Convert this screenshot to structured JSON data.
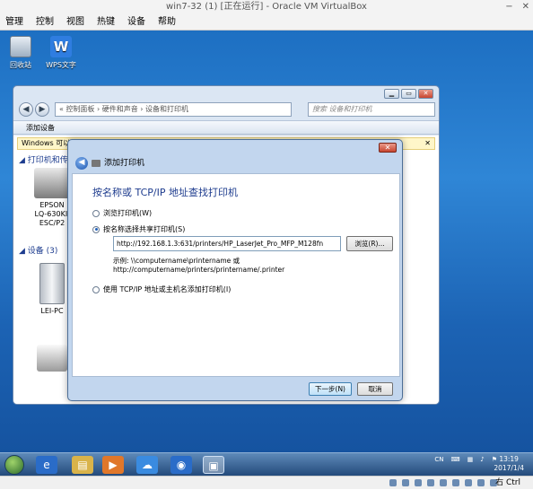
{
  "vbox": {
    "title": "win7-32 (1) [正在运行] - Oracle VM VirtualBox",
    "menu": [
      "管理",
      "控制",
      "视图",
      "热键",
      "设备",
      "帮助"
    ],
    "host_key": "右 Ctrl"
  },
  "desktop": {
    "icons": [
      {
        "label": "回收站",
        "icon": "recycle-bin-icon"
      },
      {
        "label": "WPS文字",
        "icon": "wps-writer-icon"
      }
    ]
  },
  "explorer": {
    "address": "« 控制面板 › 硬件和声音 › 设备和打印机",
    "search_placeholder": "搜索 设备和打印机",
    "toolbar_label": "添加设备",
    "info_bar": "Windows 可以显",
    "printers_group": "打印机和传",
    "devices_group": "设备 (3)",
    "printer_label_lines": [
      "EPSON",
      "LQ-630KII",
      "ESC/P2"
    ],
    "device_label": "LEI-PC"
  },
  "dialog": {
    "title": "添加打印机",
    "heading": "按名称或 TCP/IP 地址查找打印机",
    "option_browse": "浏览打印机(W)",
    "option_shared": "按名称选择共享打印机(S)",
    "url_value": "http://192.168.1.3:631/printers/HP_LaserJet_Pro_MFP_M128fn",
    "browse_button": "浏览(R)...",
    "example_line1": "示例: \\\\computername\\printername 或",
    "example_line2": "http://computername/printers/printername/.printer",
    "option_tcp": "使用 TCP/IP 地址或主机名添加打印机(I)",
    "next_button": "下一步(N)",
    "cancel_button": "取消"
  },
  "taskbar": {
    "lang": "CN",
    "time": "13:19",
    "date": "2017/1/4"
  }
}
